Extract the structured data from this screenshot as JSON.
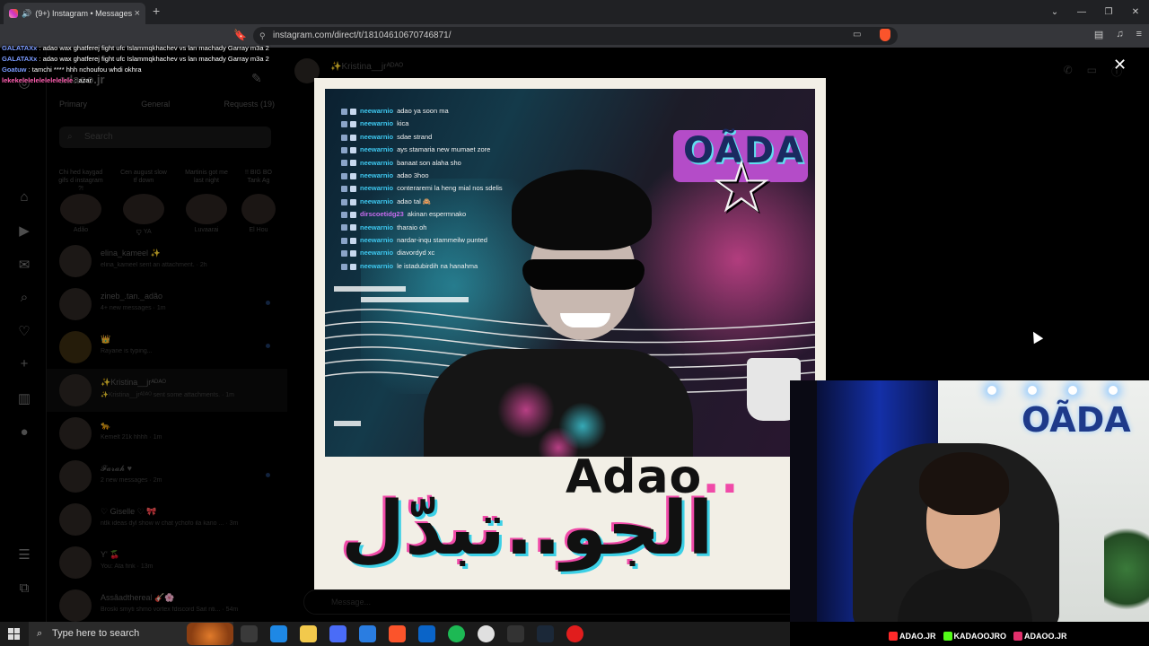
{
  "browser": {
    "tab_title": "(9+) Instagram • Messages",
    "url": "instagram.com/direct/t/18104610670746871/",
    "new_tab": "+",
    "window_controls": [
      "⌄",
      "—",
      "❐",
      "✕"
    ]
  },
  "stream_chat": [
    {
      "user": "GALATAXx",
      "text": ": adao wax ghatferej fight ufc Islammqkhachev vs lan machady Garray m3a 2",
      "user_color": "#7b9bff"
    },
    {
      "user": "GALATAXx",
      "text": ": adao wax ghatferej fight ufc Islammqkhachev vs lan machady Garray m3a 2",
      "user_color": "#7b9bff"
    },
    {
      "user": "Goatuw",
      "text": ": tamchi **** hhh nchoufou whdi okhra",
      "user_color": "#7b9bff"
    },
    {
      "user": "lekekelelelelelelelelele",
      "text": ": azar",
      "user_color": "#ff5fb0"
    }
  ],
  "instagram": {
    "account_name": "adaoo.jr",
    "tabs": [
      "Primary",
      "General",
      "Requests (19)"
    ],
    "search_placeholder": "Search",
    "notes": [
      {
        "bubble": "Chi hed kaygad gifs d instagram ?!",
        "name": "Adão"
      },
      {
        "bubble": "Cen august slow tf down",
        "name": "ꨄ YA"
      },
      {
        "bubble": "Martinis got me last night",
        "name": "Luvaarai"
      },
      {
        "bubble": "!! BIG BO Tank Ag",
        "name": "El Hou"
      }
    ],
    "conversations": [
      {
        "name": "elina_kameel ✨",
        "preview": "elina_kameel sent an attachment. · 2h",
        "unread": false
      },
      {
        "name": "zineb_.tan._adão",
        "preview": "4+ new messages · 1m",
        "unread": true
      },
      {
        "name": "👑",
        "preview": "Rayane is typing...",
        "unread": true
      },
      {
        "name": "✨Kristina__jrᴬᴰᴬᴼ",
        "preview": "✨Kristina__jrᴬᴰᴬᴼ sent some attachments. · 1m",
        "unread": false,
        "selected": true
      },
      {
        "name": "🐆",
        "preview": "Kemelt 21k hhhh · 1m",
        "unread": false
      },
      {
        "name": "𝓕𝓪𝓻𝓪𝓱 ♥",
        "preview": "2 new messages · 2m",
        "unread": true
      },
      {
        "name": "♡ Giselle ♡ 🎀",
        "preview": "ntlk ideas dyl show w chat ychofo ila kano ... · 3m",
        "unread": false
      },
      {
        "name": "Y' 🍒",
        "preview": "You: Ata fink · 13m",
        "unread": false
      },
      {
        "name": "Assâadthereal 🎸🌸",
        "preview": "Broski smyti shmo vortex fdiscord Sait nti... · 54m",
        "unread": false
      }
    ],
    "chat_header_name": "✨Kristina__jrᴬᴰᴬᴼ",
    "message_placeholder": "Message..."
  },
  "viewer": {
    "close_label": "✕",
    "art_chat": [
      {
        "user": "neewarnio",
        "text": "adao ya soon ma"
      },
      {
        "user": "neewarnio",
        "text": "kica"
      },
      {
        "user": "neewarnio",
        "text": "sdae strand"
      },
      {
        "user": "neewarnio",
        "text": "ays stamaria new mumaet zore"
      },
      {
        "user": "neewarnio",
        "text": "banaat son alaha sho"
      },
      {
        "user": "neewarnio",
        "text": "adao 3hoo"
      },
      {
        "user": "neewarnio",
        "text": "conteraremi la heng mial nos sdelis"
      },
      {
        "user": "neewarnio",
        "text": "adao tal 🙈"
      },
      {
        "user": "dirscoetidg23",
        "text": "akinan espermnako",
        "alt": true
      },
      {
        "user": "neewarnio",
        "text": "tharaio oh"
      },
      {
        "user": "neewarnio",
        "text": "nardar-inqu stammeilw punted"
      },
      {
        "user": "neewarnio",
        "text": "diavordyd xc"
      },
      {
        "user": "neewarnio",
        "text": "le istadubirdih na hanahma"
      }
    ],
    "art_logo": "OÃDA",
    "artist": "Adao",
    "artist_dots": "..",
    "arabic_title": "الجو..تبدّل"
  },
  "webcam": {
    "sign": "OÃDA",
    "socials": [
      {
        "label": "ADAO.JR",
        "color": "#ff2a2a"
      },
      {
        "label": "KADAOOJRO",
        "color": "#53fc18"
      },
      {
        "label": "ADAOO.JR",
        "color": "#e1306c"
      }
    ]
  },
  "taskbar": {
    "search_placeholder": "Type here to search",
    "apps": [
      {
        "icon": "task-view-icon",
        "color": "#3a3a3a"
      },
      {
        "icon": "edge-icon",
        "color": "#1e88e5"
      },
      {
        "icon": "file-explorer-icon",
        "color": "#f2c94c"
      },
      {
        "icon": "creative-cloud-icon",
        "color": "#4a6cf7"
      },
      {
        "icon": "store-icon",
        "color": "#2a7de1"
      },
      {
        "icon": "brave-icon",
        "color": "#fb542b"
      },
      {
        "icon": "outlook-icon",
        "color": "#0a64c8"
      },
      {
        "icon": "spotify-icon",
        "color": "#1db954"
      },
      {
        "icon": "chrome-icon",
        "color": "#e0e0e0"
      },
      {
        "icon": "cap-icon",
        "color": "#333333"
      },
      {
        "icon": "steam-icon",
        "color": "#1b2838"
      },
      {
        "icon": "youtube-icon",
        "color": "#e11d1d"
      }
    ]
  }
}
